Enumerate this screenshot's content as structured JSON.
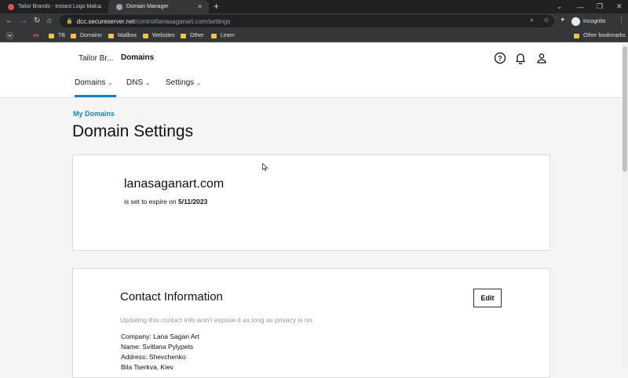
{
  "browser": {
    "tabs": [
      {
        "title": "Tailor Brands - Instant Logo Mak..."
      },
      {
        "title": "Domain Manager"
      }
    ],
    "url_host": "dcc.secureserver.net",
    "url_path": "/control/lanasaganart.com/settings",
    "profile_label": "Incognito",
    "bookmarks": [
      "TB",
      "Domains",
      "Mailbox",
      "Websites",
      "Other",
      "Learn"
    ],
    "other_bookmarks": "Other bookmarks",
    "colors": {
      "chrome_dark": "#202124",
      "chrome_bar": "#35363a",
      "folder": "#f5c542"
    }
  },
  "header": {
    "brand": "Tailor Br...",
    "product": "Domains",
    "icons": [
      "help-icon",
      "bell-icon",
      "user-icon"
    ]
  },
  "nav": {
    "tabs": [
      {
        "label": "Domains",
        "active": true
      },
      {
        "label": "DNS",
        "active": false
      },
      {
        "label": "Settings",
        "active": false
      }
    ],
    "accent": "#1b7fbd"
  },
  "breadcrumb": "My Domains",
  "page_title": "Domain Settings",
  "domain_card": {
    "domain": "lanasaganart.com",
    "expire_prefix": "is set to expire on",
    "expire_date": "5/11/2023"
  },
  "contact_card": {
    "title": "Contact Information",
    "edit_label": "Edit",
    "note": "Updating this contact info won't expose it as long as privacy is on.",
    "lines": [
      "Company: Lana Sagan Art",
      "Name: Svitlana Pylypets",
      "Address: Shevchenko",
      "Bila Tserkva, Kiev"
    ]
  }
}
